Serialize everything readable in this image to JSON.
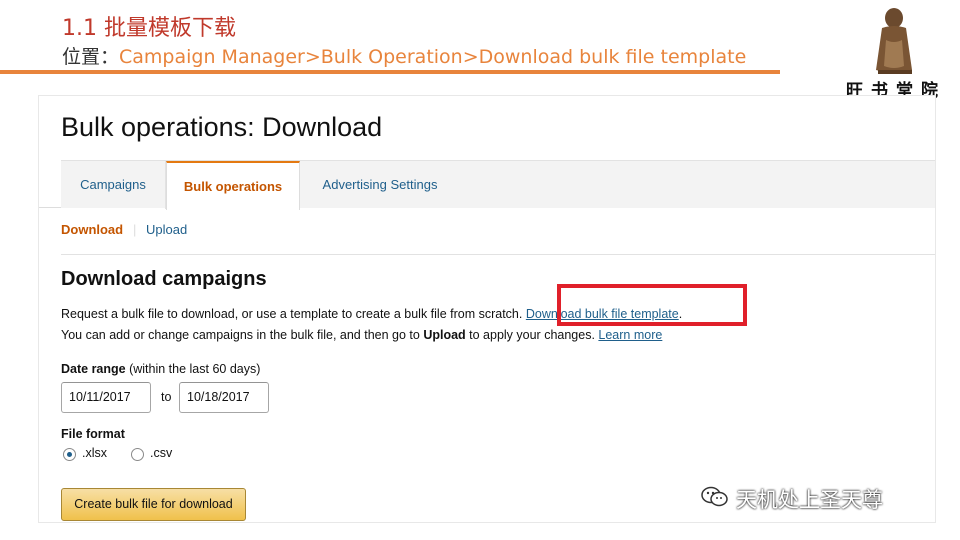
{
  "slide": {
    "title": "1.1 批量模板下载",
    "location_prefix": "位置：",
    "location_path": "Campaign  Manager>Bulk Operation>Download bulk file template"
  },
  "colors": {
    "accent_orange": "#e8843c",
    "title_red": "#c0392b",
    "highlight_red": "#e0202a",
    "link_blue": "#1f5f8b",
    "active_orange": "#c45500"
  },
  "app": {
    "page_title": "Bulk operations: Download",
    "tabs": [
      {
        "label": "Campaigns",
        "active": false
      },
      {
        "label": "Bulk operations",
        "active": true
      },
      {
        "label": "Advertising Settings",
        "active": false
      }
    ],
    "subnav": {
      "download": "Download",
      "separator": "|",
      "upload": "Upload"
    },
    "section_heading": "Download campaigns",
    "para1_text": "Request a bulk file to download, or use a template to create a bulk file from scratch.",
    "para1_link": "Download bulk file template",
    "para1_end": ".",
    "para2_start": "You can add or change campaigns in the bulk file, and then go to ",
    "para2_bold": "Upload",
    "para2_end": " to apply your changes. ",
    "para2_link": "Learn more",
    "date_range_label": "Date range",
    "date_range_hint": " (within the last 60 days)",
    "date_from": "10/11/2017",
    "date_to_label": "to",
    "date_to": "10/18/2017",
    "file_format_label": "File format",
    "formats": [
      {
        "label": ".xlsx",
        "checked": true
      },
      {
        "label": ".csv",
        "checked": false
      }
    ],
    "create_button": "Create bulk file for download"
  },
  "watermark": {
    "icon": "wechat-icon",
    "text": "天机处上圣天尊"
  },
  "logo": {
    "text": "旺书堂院"
  }
}
